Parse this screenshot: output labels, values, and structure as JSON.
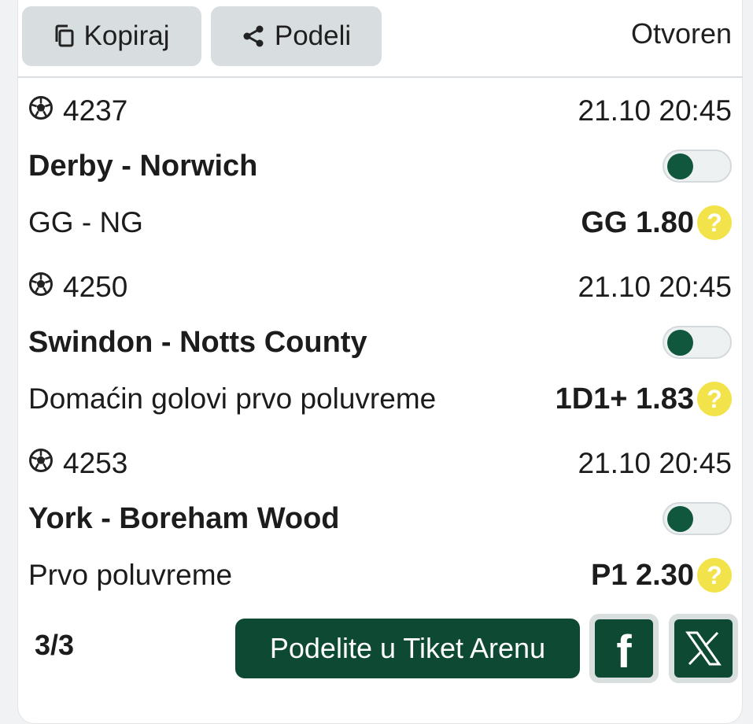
{
  "toolbar": {
    "copy_label": "Kopiraj",
    "share_label": "Podeli",
    "status": "Otvoren"
  },
  "matches": [
    {
      "code": "4237",
      "datetime": "21.10 20:45",
      "teams": "Derby - Norwich",
      "market": "GG - NG",
      "pick": "GG 1.80"
    },
    {
      "code": "4250",
      "datetime": "21.10 20:45",
      "teams": "Swindon - Notts County",
      "market": "Domaćin golovi prvo poluvreme",
      "pick": "1D1+ 1.83"
    },
    {
      "code": "4253",
      "datetime": "21.10 20:45",
      "teams": "York - Boreham Wood",
      "market": "Prvo poluvreme",
      "pick": "P1 2.30"
    }
  ],
  "footer": {
    "count": "3/3",
    "share_arena_label": "Podelite u Tiket Arenu",
    "facebook_glyph": "f"
  },
  "help_glyph": "?",
  "colors": {
    "accent": "#0e4a33",
    "help": "#f2e34a",
    "button_bg": "#d8dde0"
  },
  "icons": [
    "copy-icon",
    "share-icon",
    "soccer-ball-icon",
    "help-icon",
    "facebook-icon",
    "x-logo-icon"
  ]
}
